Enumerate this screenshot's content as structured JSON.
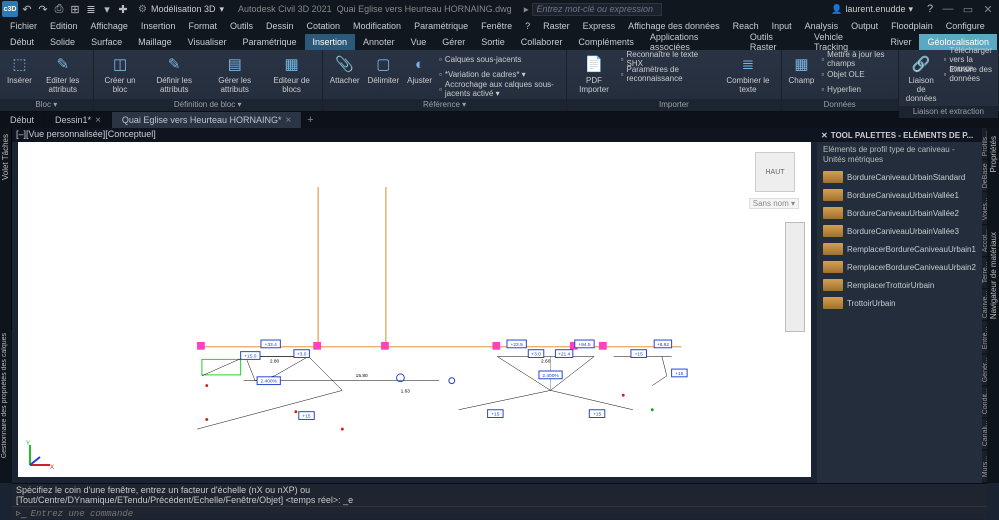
{
  "app": {
    "name": "c3D",
    "workspace_gear": "⚙",
    "workspace": "Modélisation 3D",
    "title": "Autodesk Civil 3D 2021",
    "filename": "Quai Eglise vers Heurteau HORNAING.dwg",
    "search_ph": "Entrez mot-clé ou expression",
    "user": "laurent.enudde"
  },
  "qa": [
    "↶",
    "↷",
    "⎙",
    "⊞",
    "≣",
    "▾",
    "✚"
  ],
  "menu": [
    "Fichier",
    "Edition",
    "Affichage",
    "Insertion",
    "Format",
    "Outils",
    "Dessin",
    "Cotation",
    "Modification",
    "Paramétrique",
    "Fenêtre",
    "?",
    "Raster",
    "Express",
    "Affichage des données",
    "Reach",
    "Input",
    "Analysis",
    "Output",
    "Floodplain",
    "Configure"
  ],
  "tabs": {
    "items": [
      "Début",
      "Solide",
      "Surface",
      "Maillage",
      "Visualiser",
      "Paramétrique",
      "Insertion",
      "Annoter",
      "Vue",
      "Gérer",
      "Sortie",
      "Collaborer",
      "Compléments",
      "Applications associées",
      "Outils Raster",
      "Vehicle Tracking",
      "River",
      "Géolocalisation"
    ],
    "active": "Insertion",
    "active2": "Géolocalisation"
  },
  "ribbon": {
    "bloc": {
      "label": "Bloc ▾",
      "insert": "Insérer",
      "edit": "Editer\nles attributs",
      "create": "Créer\nun bloc",
      "definir": "Définir\nles attributs",
      "gerer": "Gérer les\nattributs",
      "editeur": "Editeur\nde blocs",
      "def_label": "Définition de bloc ▾"
    },
    "ref": {
      "label": "Référence ▾",
      "attach": "Attacher",
      "clip": "Délimiter",
      "adjust": "Ajuster",
      "l1": "Calques sous-jacents",
      "l2": "*Variation de cadres* ▾",
      "l3": "Accrochage aux calques sous-jacents activé ▾"
    },
    "import": {
      "label": "Importer",
      "pdf": "PDF\nImporter",
      "l1": "Reconnaître le texte SHX",
      "l2": "Paramètres de reconnaissance",
      "combine": "Combiner\nle texte"
    },
    "data": {
      "label": "Données",
      "champ": "Champ",
      "l1": "Mettre à jour les champs",
      "l2": "Objet OLE",
      "l3": "Hyperlien"
    },
    "link": {
      "label": "Liaison et extraction",
      "lien": "Liaison\nde données",
      "l1": "Télécharger vers la source",
      "l2": "Extraire des  données"
    }
  },
  "doc_tabs": [
    "Début",
    "Dessin1*",
    "Quai Eglise vers Heurteau HORNAING*"
  ],
  "viewport": {
    "label": "[–][Vue personnalisée][Conceptuel]",
    "cube": "HAUT",
    "sans": "Sans nom ▾"
  },
  "palette": {
    "title": "TOOL PALETTES - ELÉMENTS DE P...",
    "subtitle": "Eléments de profil type de caniveau - Unités métriques",
    "items": [
      "BordureCaniveauUrbainStandard",
      "BordureCaniveauUrbainVallée1",
      "BordureCaniveauUrbainVallée2",
      "BordureCaniveauUrbainVallée3",
      "RemplacerBordureCaniveauUrbain1",
      "RemplacerBordureCaniveauUrbain2",
      "RemplacerTrottoirUrbain",
      "TrottoirUrbain"
    ],
    "tabs": [
      "Profils...",
      "DeBase",
      "Voies...",
      "Accot...",
      "Terre...",
      "Canive...",
      "Entré...",
      "Génér...",
      "Condit...",
      "Canali...",
      "Murs..."
    ],
    "side_r": [
      "Propriétés",
      "Navigateur de matériaux"
    ],
    "side_l": "Volet Tâches",
    "side_bl": "Gestionnaire des propriétés des calques"
  },
  "cmd": {
    "log": "Spécifiez le coin d'une fenêtre, entrez un facteur d'échelle (nX ou nXP) ou\n[Tout/Centre/DYnamique/ETendu/Précédent/Echelle/Fenêtre/Objet] <temps réel>: _e",
    "placeholder": "Entrez une commande"
  },
  "drawing": {
    "labels": [
      "+15.0",
      "+33.4",
      "+3.0",
      "2.400%",
      "+15",
      "+23.5",
      "+3.0",
      "+94.5",
      "+21.4",
      "2.400%",
      "+15",
      "+15",
      "+15",
      "+8.82",
      "+15",
      "2.80",
      "15.80",
      "2.60",
      "1.63"
    ]
  }
}
